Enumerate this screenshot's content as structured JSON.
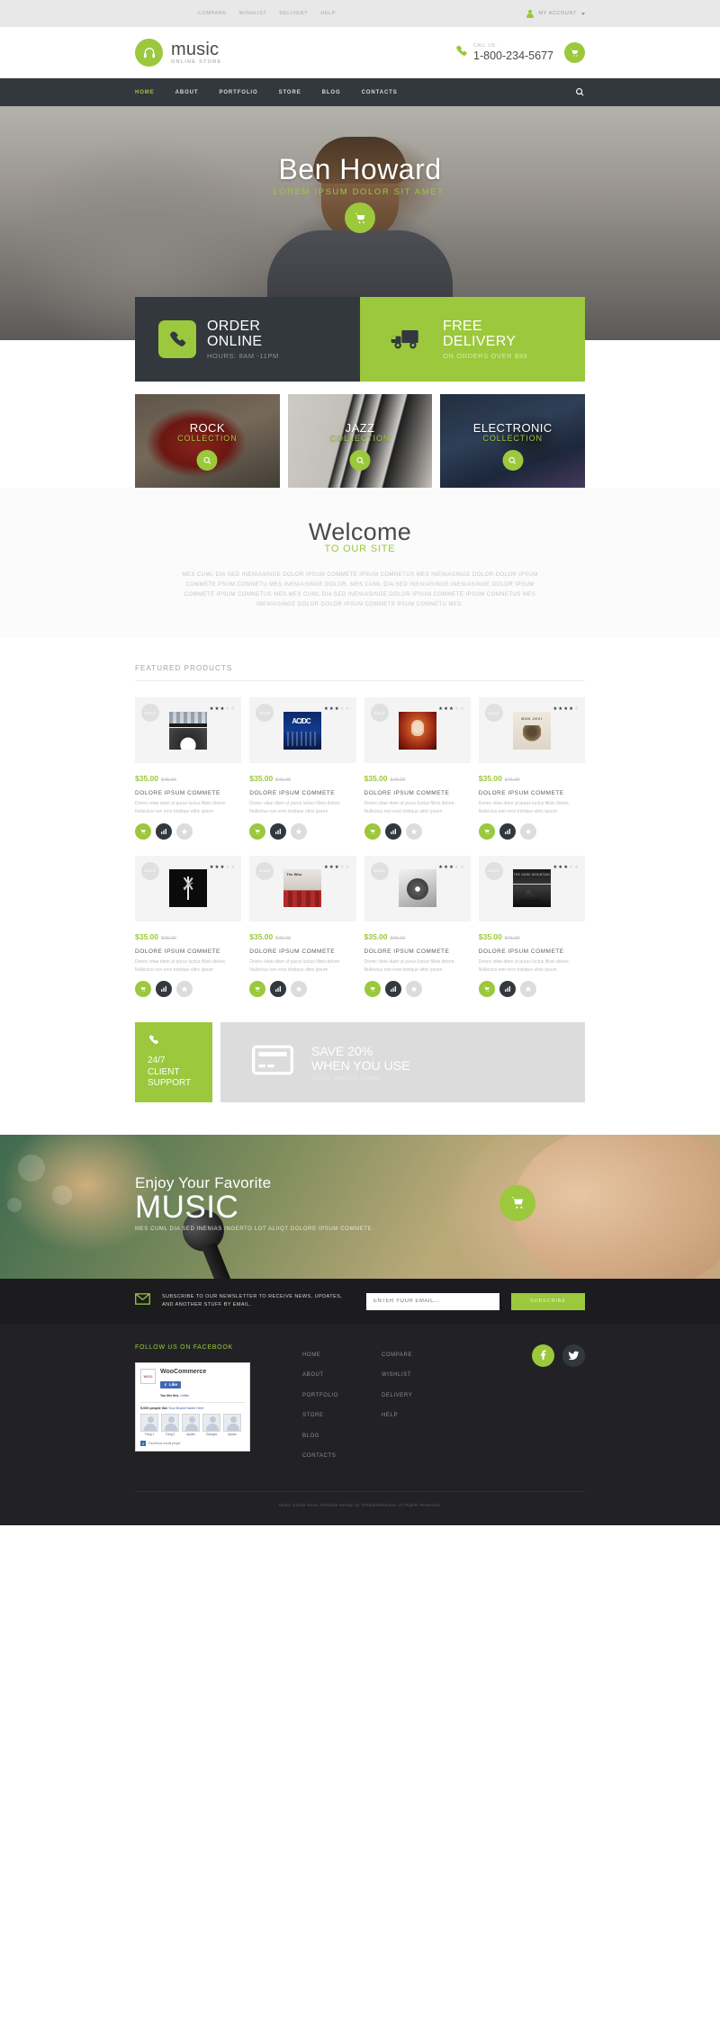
{
  "topbar": {
    "links": [
      "COMPARE",
      "WISHLIST",
      "DELIVERY",
      "HELP"
    ],
    "account_label": "MY ACCOUNT",
    "account_icon": "user-icon",
    "caret_icon": "chevron-down-icon"
  },
  "header": {
    "logo_icon": "headphones-icon",
    "logo_name": "music",
    "logo_sub": "ONLINE STORE",
    "phone_icon": "phone-icon",
    "call_label": "CALL US:",
    "call_number": "1-800-234-5677",
    "cart_icon": "shopping-cart-icon"
  },
  "nav": {
    "items": [
      {
        "label": "HOME",
        "active": true
      },
      {
        "label": "ABOUT",
        "active": false
      },
      {
        "label": "PORTFOLIO",
        "active": false
      },
      {
        "label": "STORE",
        "active": false
      },
      {
        "label": "BLOG",
        "active": false
      },
      {
        "label": "CONTACTS",
        "active": false
      }
    ],
    "search_icon": "search-icon"
  },
  "hero": {
    "title": "Ben Howard",
    "subtitle": "LOREM IPSUM DOLOR SIT AMET.",
    "cart_icon": "shopping-cart-icon"
  },
  "promos": [
    {
      "icon": "phone-icon",
      "title_line1": "ORDER",
      "title_line2": "ONLINE",
      "subtitle": "HOURS: 8AM -11PM",
      "style": "dark"
    },
    {
      "icon": "delivery-truck-icon",
      "title_line1": "FREE",
      "title_line2": "DELIVERY",
      "subtitle": "ON ORDERS OVER $99",
      "style": "green"
    }
  ],
  "collections": [
    {
      "name": "ROCK",
      "sub": "COLLECTION",
      "icon": "search-icon"
    },
    {
      "name": "JAZZ",
      "sub": "COLLECTION",
      "icon": "search-icon"
    },
    {
      "name": "ELECTRONIC",
      "sub": "COLLECTION",
      "icon": "search-icon"
    }
  ],
  "welcome": {
    "title": "Welcome",
    "subtitle": "TO OUR SITE",
    "text": "MES CUML DIA SED INENIASINGE DOLOR IPSUM COMMETE IPSUM COMNETUS MES INENIASINGE DOLOR.DOLOR IPSUM COMMETE PSUM COMNETU MES INENIASINGE DOLOR. MES CUML DIA SED INENIASINGE INENIASINGE DOLOR IPSUM COMMETE IPSUM COMNETUS MES.MES CUML DIA SED INENIASINGE DOLOR IPSUM COMMETE IPSUM COMNETUS MES INENIASINGE DOLOR.DOLOR IPSUM COMMETE PSUM COMNETU MES."
  },
  "featured": {
    "heading": "FEATURED PRODUCTS",
    "sale_badge": "SALE",
    "products": [
      {
        "price": "$35.00",
        "old_price": "$45.00",
        "name": "DOLORE IPSUM COMMETE",
        "desc": "Donec vitae diam ut purus luctus filisis dolore. Nullectus non eros tristique ultric ipsum",
        "rating": 3,
        "album": "a-day-to-remember"
      },
      {
        "price": "$35.00",
        "old_price": "$45.00",
        "name": "DOLORE IPSUM COMMETE",
        "desc": "Donec vitae diam ut purus luctus filisis dolore. Nullectus non eros tristique ultric ipsum",
        "rating": 3,
        "album": "ac-dc-blue"
      },
      {
        "price": "$35.00",
        "old_price": "$45.00",
        "name": "DOLORE IPSUM COMMETE",
        "desc": "Donec vitae diam ut purus luctus filisis dolore. Nullectus non eros tristique ultric ipsum",
        "rating": 3,
        "album": "orange-portrait"
      },
      {
        "price": "$35.00",
        "old_price": "$45.00",
        "name": "DOLORE IPSUM COMMETE",
        "desc": "Donec vitae diam ut purus luctus filisis dolore. Nullectus non eros tristique ultric ipsum",
        "rating": 4,
        "album": "bon-jovi"
      },
      {
        "price": "$35.00",
        "old_price": "$45.00",
        "name": "DOLORE IPSUM COMMETE",
        "desc": "Donec vitae diam ut purus luctus filisis dolore. Nullectus non eros tristique ultric ipsum",
        "rating": 3,
        "album": "black-white-tree"
      },
      {
        "price": "$35.00",
        "old_price": "$45.00",
        "name": "DOLORE IPSUM COMMETE",
        "desc": "Donec vitae diam ut purus luctus filisis dolore. Nullectus non eros tristique ultric ipsum",
        "rating": 3,
        "album": "the-who-red"
      },
      {
        "price": "$35.00",
        "old_price": "$45.00",
        "name": "DOLORE IPSUM COMMETE",
        "desc": "Donec vitae diam ut purus luctus filisis dolore. Nullectus non eros tristique ultric ipsum",
        "rating": 3,
        "album": "grey-cover"
      },
      {
        "price": "$35.00",
        "old_price": "$45.00",
        "name": "DOLORE IPSUM COMMETE",
        "desc": "Donec vitae diam ut purus luctus filisis dolore. Nullectus non eros tristique ultric ipsum",
        "rating": 3,
        "album": "dark-horizon"
      }
    ],
    "action_icons": {
      "cart": "shopping-cart-icon",
      "compare": "compare-bars-icon",
      "wishlist": "star-icon"
    }
  },
  "support": {
    "icon": "phone-icon",
    "line1": "24/7",
    "line2": "CLIENT",
    "line3": "SUPPORT"
  },
  "credit_card": {
    "icon": "credit-card-icon",
    "line1": "SAVE 20%",
    "line2": "WHEN YOU USE",
    "sub": "YOUR CREDIT CARD"
  },
  "music_cta": {
    "line1": "Enjoy Your Favorite",
    "line2": "MUSIC",
    "sub": "MES CUML DIA SED INENIAS INGERTO LOT ALIIQT DOLORE IPSUM COMMETE.",
    "cart_icon": "shopping-cart-icon"
  },
  "newsletter": {
    "icon": "envelope-icon",
    "text": "SUBSCRIBE TO OUR NEWSLETTER TO RECEIVE NEWS, UPDATES, AND ANOTHER STUFF BY EMAIL.",
    "placeholder": "ENTER YOUR EMAIL...",
    "value": "",
    "button": "SUBSCRIBE"
  },
  "footer": {
    "fb_title": "FOLLOW US ON FACEBOOK",
    "fb_widget": {
      "page_name": "WooCommerce",
      "like_label": "Like",
      "like_icon": "facebook-icon",
      "you_like": "You like this.",
      "unlike": "Unlike",
      "count_bold": "5,000 people like",
      "count_link": "Your Brand Name Here",
      "faces": [
        "Thing 1",
        "Thing 2",
        "Apples",
        "Oranges",
        "Apples"
      ],
      "plugin_label": "Facebook social plugin"
    },
    "nav_col1": [
      "HOME",
      "ABOUT",
      "PORTFOLIO",
      "STORE",
      "BLOG",
      "CONTACTS"
    ],
    "nav_col2": [
      "COMPARE",
      "WISHLIST",
      "DELIVERY",
      "HELP"
    ],
    "social": [
      {
        "name": "facebook",
        "icon": "facebook-icon"
      },
      {
        "name": "twitter",
        "icon": "twitter-icon"
      }
    ],
    "copyright": "Music Online Store Template Design by TemplateMonster. All Rights Reserved."
  }
}
